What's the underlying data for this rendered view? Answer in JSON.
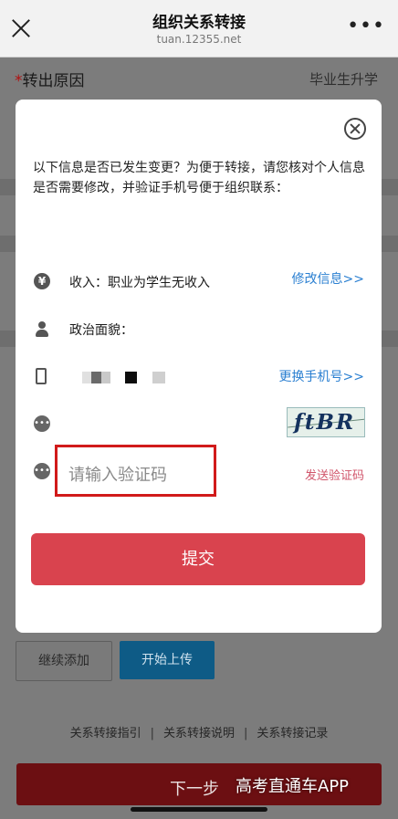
{
  "header": {
    "title": "组织关系转接",
    "domain": "tuan.12355.net"
  },
  "form": {
    "reason_label": "转出原因",
    "required_mark": "*",
    "reason_value": "毕业生升学"
  },
  "modal": {
    "prompt": "以下信息是否已发生变更？为便于转接，请您核对个人信息是否需要修改，并验证手机号便于组织联系：",
    "income_text": "收入：职业为学生无收入",
    "edit_info_link": "修改信息>>",
    "political_text": "政治面貌：",
    "change_phone_link": "更换手机号>>",
    "captcha_text": "ftBR",
    "code_placeholder": "请输入验证码",
    "send_code_label": "发送验证码",
    "submit_label": "提交",
    "icons": [
      "yen-icon",
      "person-icon",
      "phone-icon",
      "chat-icon",
      "chat-icon"
    ]
  },
  "actions": {
    "continue_label": "继续添加",
    "upload_label": "开始上传"
  },
  "links": [
    "关系转接指引",
    "关系转接说明",
    "关系转接记录"
  ],
  "link_separator": "|",
  "next_label": "下一步",
  "watermark": "高考直通车APP",
  "colors": {
    "submit": "#d9434e",
    "link": "#2a7fd1",
    "send_code": "#d0546a",
    "highlight": "#d11a1a",
    "upload": "#0e5b86",
    "next": "#6c0f12"
  }
}
